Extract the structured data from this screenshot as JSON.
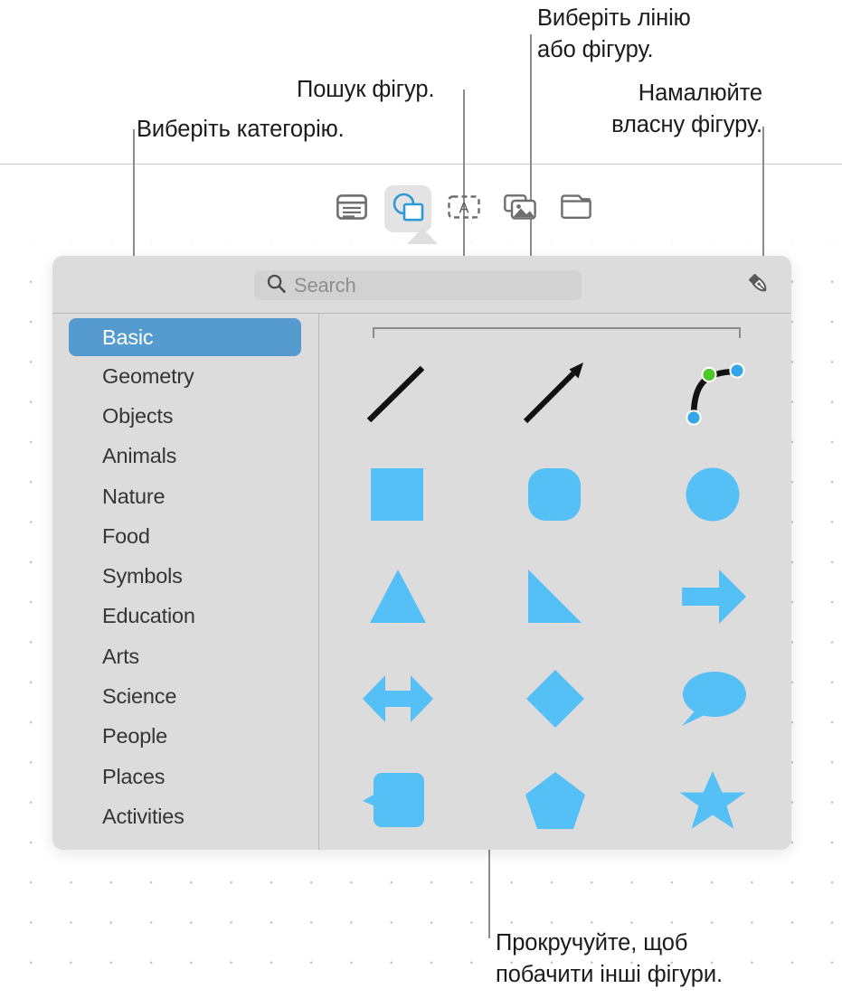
{
  "callouts": [
    {
      "name": "choose-category",
      "text": "Виберіть категорію."
    },
    {
      "name": "search-shapes",
      "text": "Пошук фігур."
    },
    {
      "name": "choose-line-or-shape",
      "text": "Виберіть лінію\nабо фігуру."
    },
    {
      "name": "draw-your-own-shape",
      "text": "Намалюйте\nвласну фігуру."
    },
    {
      "name": "scroll-for-more-shapes",
      "text": "Прокручуйте, щоб\nпобачити інші фігури."
    }
  ],
  "toolbar": {
    "items": [
      {
        "icon": "table-icon",
        "label": "Table",
        "selected": false
      },
      {
        "icon": "shape-icon",
        "label": "Shape",
        "selected": true
      },
      {
        "icon": "text-box-icon",
        "label": "Text",
        "selected": false
      },
      {
        "icon": "media-icon",
        "label": "Media",
        "selected": false
      },
      {
        "icon": "folder-icon",
        "label": "Folder",
        "selected": false
      }
    ]
  },
  "popover": {
    "search": {
      "icon": "search-icon",
      "placeholder": "Search",
      "value": ""
    },
    "draw_button": {
      "icon": "pen-icon",
      "label": "Draw"
    },
    "categories": [
      {
        "label": "Basic",
        "selected": true
      },
      {
        "label": "Geometry",
        "selected": false
      },
      {
        "label": "Objects",
        "selected": false
      },
      {
        "label": "Animals",
        "selected": false
      },
      {
        "label": "Nature",
        "selected": false
      },
      {
        "label": "Food",
        "selected": false
      },
      {
        "label": "Symbols",
        "selected": false
      },
      {
        "label": "Education",
        "selected": false
      },
      {
        "label": "Arts",
        "selected": false
      },
      {
        "label": "Science",
        "selected": false
      },
      {
        "label": "People",
        "selected": false
      },
      {
        "label": "Places",
        "selected": false
      },
      {
        "label": "Activities",
        "selected": false
      }
    ],
    "shapes": [
      [
        {
          "name": "line-shape",
          "label": "Line"
        },
        {
          "name": "arrow-line-shape",
          "label": "Arrow"
        },
        {
          "name": "curve-shape",
          "label": "Curve"
        }
      ],
      [
        {
          "name": "square-shape",
          "label": "Square"
        },
        {
          "name": "rounded-square-shape",
          "label": "Rounded Square"
        },
        {
          "name": "circle-shape",
          "label": "Circle"
        }
      ],
      [
        {
          "name": "triangle-shape",
          "label": "Triangle"
        },
        {
          "name": "right-triangle-shape",
          "label": "Right Triangle"
        },
        {
          "name": "right-arrow-shape",
          "label": "Right Arrow"
        }
      ],
      [
        {
          "name": "double-arrow-shape",
          "label": "Double Arrow"
        },
        {
          "name": "diamond-shape",
          "label": "Diamond"
        },
        {
          "name": "speech-bubble-shape",
          "label": "Speech Bubble"
        }
      ],
      [
        {
          "name": "rounded-callout-shape",
          "label": "Rounded Callout"
        },
        {
          "name": "pentagon-shape",
          "label": "Pentagon"
        },
        {
          "name": "star-shape",
          "label": "Star"
        }
      ]
    ]
  },
  "colors": {
    "shape_fill": "#55c0f5",
    "accent_selected": "#559bd0",
    "popover_bg": "#dcdcdc",
    "handle_blue": "#35a5e8",
    "handle_green": "#4ec72b",
    "toolbar_icon": "#6e6e6e",
    "toolbar_icon_active": "#2b9ad6"
  }
}
